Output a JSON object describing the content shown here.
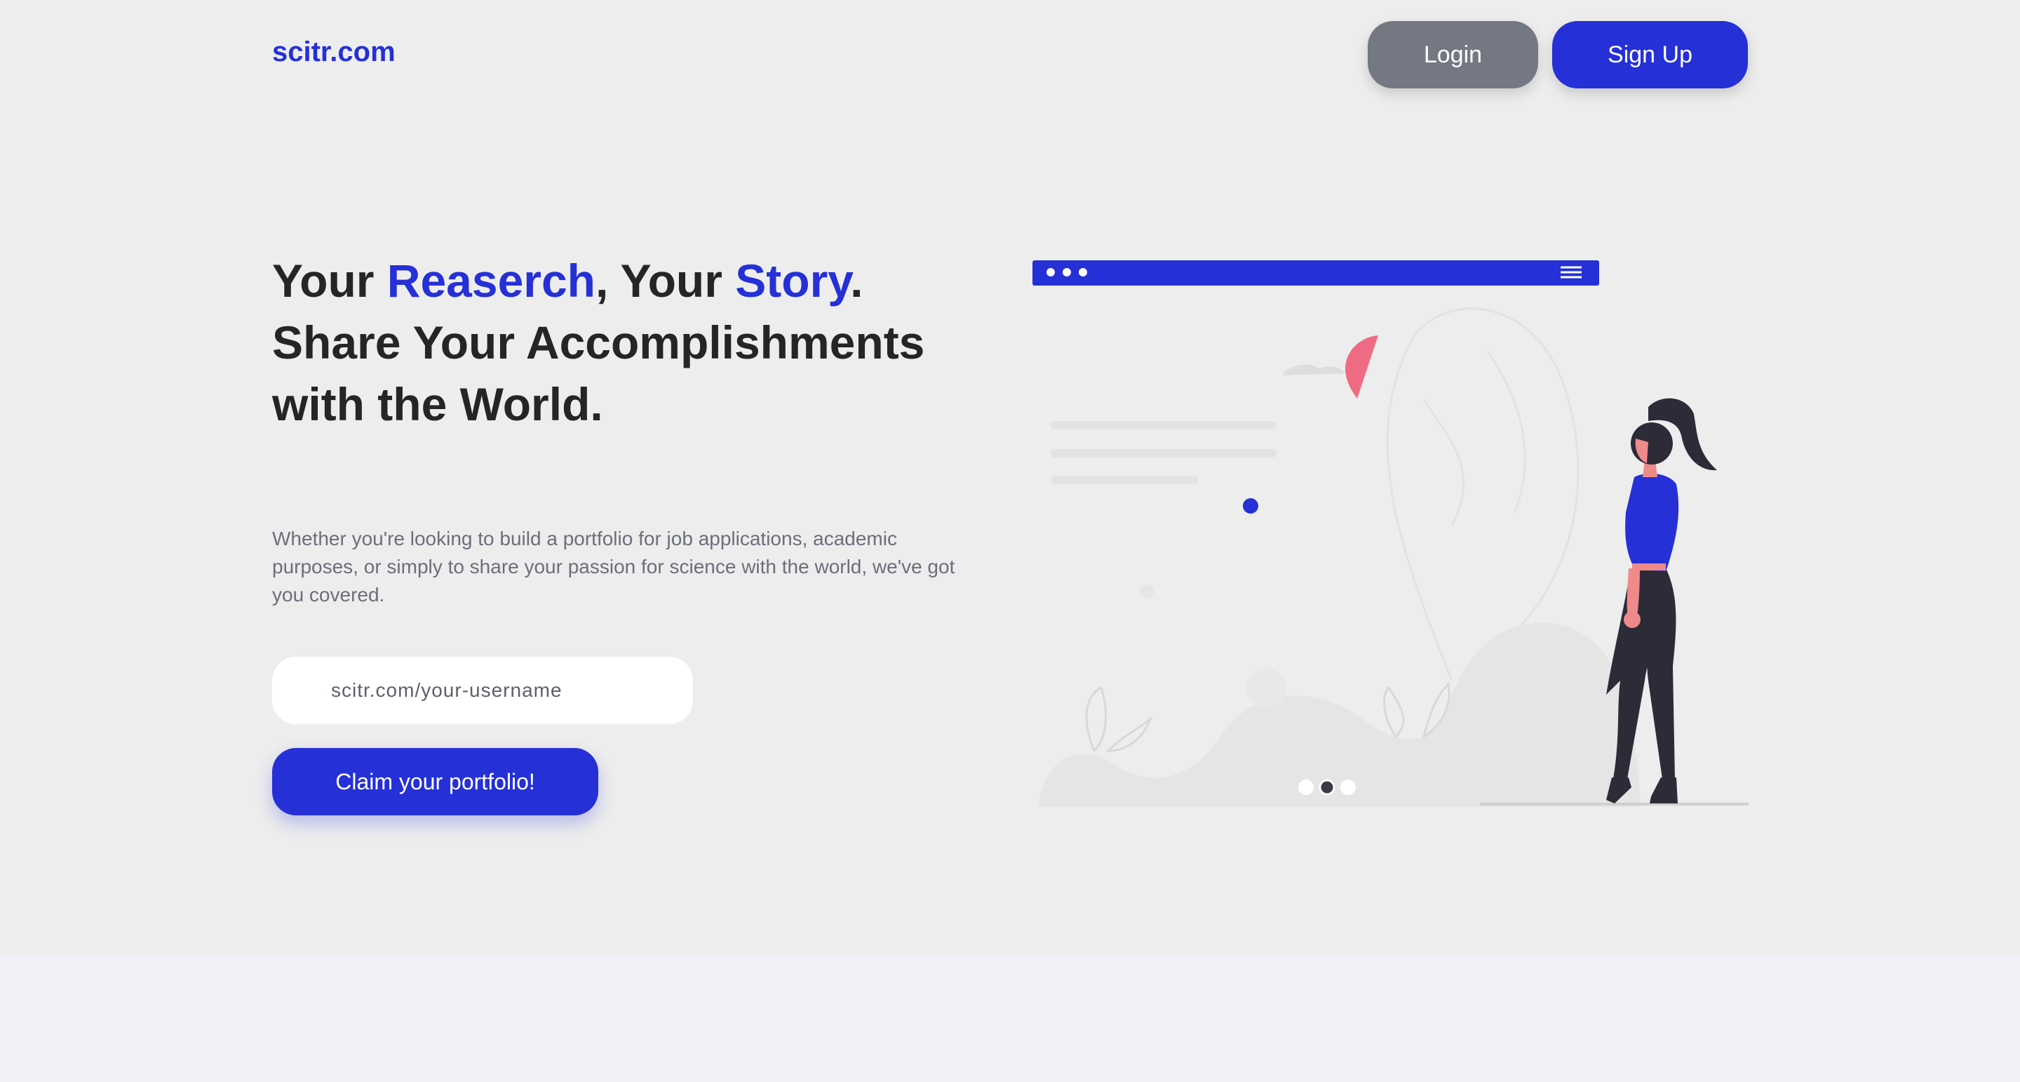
{
  "header": {
    "logo": "scitr.com",
    "login_label": "Login",
    "signup_label": "Sign Up"
  },
  "hero": {
    "headline": {
      "part1": "Your ",
      "accent1": "Reaserch",
      "part2": ", Your ",
      "accent2": "Story",
      "part3": ".",
      "line2": "Share Your Accomplishments",
      "line3": "with the World."
    },
    "subtitle": "Whether you're looking to build a portfolio for job applications, academic purposes, or simply to share your passion for science with the world, we've got you covered.",
    "username_placeholder": "scitr.com/your-username",
    "cta_label": "Claim your portfolio!"
  },
  "colors": {
    "brand": "#2530d6",
    "login_bg": "#737883",
    "hero_bg": "#ededed",
    "footer_bg": "#f1f2f7",
    "text_dark": "#252525",
    "text_muted": "#6b6f7a",
    "accent_pink": "#ef6b84"
  },
  "illustration": {
    "menu_icon": "hamburger-menu-icon",
    "carousel_dots_count": 3,
    "carousel_active_dot": 2
  }
}
